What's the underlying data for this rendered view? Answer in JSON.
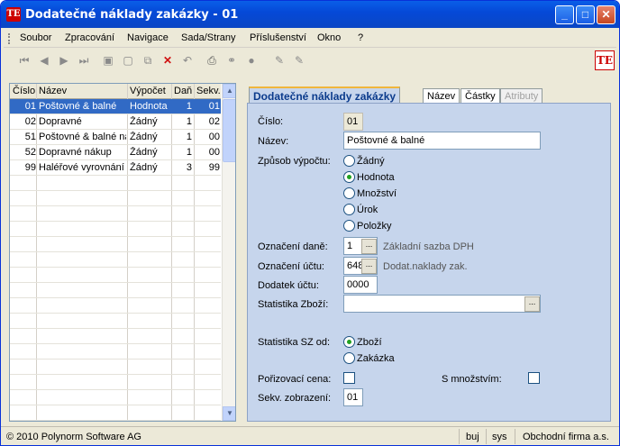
{
  "window": {
    "title": "Dodatečné náklady zakázky - 01",
    "app_icon": "TE",
    "min": "_",
    "max": "□",
    "close": "✕"
  },
  "menu": [
    "Soubor",
    "Zpracování",
    "Navigace",
    "Sada/Strany",
    "Příslušenství",
    "Okno",
    "?"
  ],
  "toolbar": {
    "icons": [
      "first-icon",
      "prev-icon",
      "next-icon",
      "last-icon",
      "save-icon",
      "new-icon",
      "copy-icon",
      "delete-icon",
      "undo-icon",
      "print-icon",
      "link-icon",
      "stop-icon",
      "edit-icon",
      "edit2-icon"
    ],
    "logo": "TE"
  },
  "grid": {
    "columns": [
      "Číslo",
      "Název",
      "Výpočet",
      "Daň",
      "Sekv."
    ],
    "rows": [
      {
        "cislo": "01",
        "nazev": "Poštovné & balné",
        "vypocet": "Hodnota",
        "dan": "1",
        "sekv": "01"
      },
      {
        "cislo": "02",
        "nazev": "Dopravné",
        "vypocet": "Žádný",
        "dan": "1",
        "sekv": "02"
      },
      {
        "cislo": "51",
        "nazev": "Poštovné & balné ná",
        "vypocet": "Žádný",
        "dan": "1",
        "sekv": "00"
      },
      {
        "cislo": "52",
        "nazev": "Dopravné nákup",
        "vypocet": "Žádný",
        "dan": "1",
        "sekv": "00"
      },
      {
        "cislo": "99",
        "nazev": "Haléřové vyrovnání",
        "vypocet": "Žádný",
        "dan": "3",
        "sekv": "99"
      }
    ]
  },
  "tabs": [
    "Dodatečné náklady zakázky",
    "Název",
    "Částky",
    "Atributy"
  ],
  "form": {
    "cislo_label": "Číslo:",
    "cislo": "01",
    "nazev_label": "Název:",
    "nazev": "Poštovné & balné",
    "zpusob_label": "Způsob výpočtu:",
    "zpusob_options": [
      "Žádný",
      "Hodnota",
      "Množství",
      "Úrok",
      "Položky"
    ],
    "zpusob_selected": "Hodnota",
    "dan_label": "Označení daně:",
    "dan": "1",
    "dan_hint": "Základní sazba DPH",
    "ucet_label": "Označení účtu:",
    "ucet": "648",
    "ucet_hint": "Dodat.naklady zak.",
    "dodatek_label": "Dodatek účtu:",
    "dodatek": "0000",
    "stat_label": "Statistika Zboží:",
    "stat": "",
    "stat_sz_label": "Statistika SZ od:",
    "stat_sz_options": [
      "Zboží",
      "Zakázka"
    ],
    "stat_sz_selected": "Zboží",
    "poriz_label": "Pořizovací cena:",
    "smnoz_label": "S množstvím:",
    "sekv_label": "Sekv. zobrazení:",
    "sekv": "01",
    "dots": "..."
  },
  "status": {
    "copyright": "© 2010 Polynorm Software AG",
    "user": "buj",
    "db": "sys",
    "company": "Obchodní firma a.s."
  }
}
